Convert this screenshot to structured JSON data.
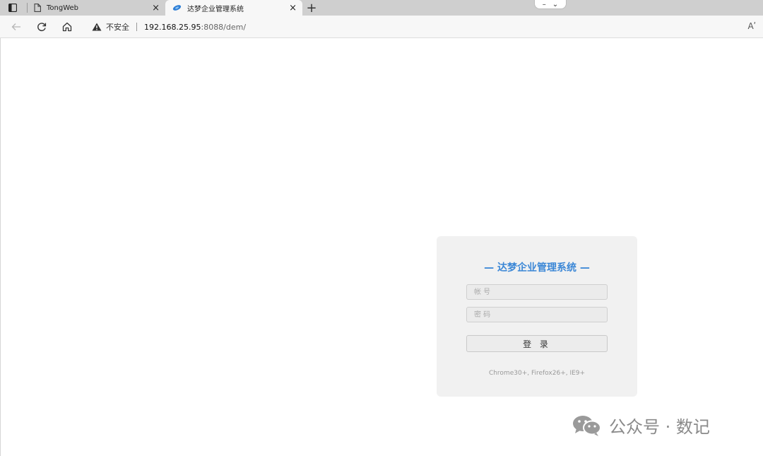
{
  "browser": {
    "tabs": [
      {
        "title": "TongWeb",
        "active": false,
        "icon": "page-icon"
      },
      {
        "title": "达梦企业管理系统",
        "active": true,
        "icon": "site-favicon-icon"
      }
    ],
    "close_glyph": "×",
    "new_tab_glyph": "+",
    "window_pill": {
      "minimize_glyph": "–",
      "chevron_glyph": "⌄"
    },
    "address": {
      "security_label": "不安全",
      "host": "192.168.25.95",
      "path": ":8088/dem/"
    },
    "read_aloud_label": "Aʹ"
  },
  "login": {
    "title": "— 达梦企业管理系统 —",
    "account_placeholder": "帐 号",
    "password_placeholder": "密 码",
    "submit_label": "登 录",
    "browser_support": "Chrome30+, Firefox26+, IE9+",
    "accent_color": "#3b87d6"
  },
  "watermark": {
    "text": "公众号 · 数记"
  }
}
